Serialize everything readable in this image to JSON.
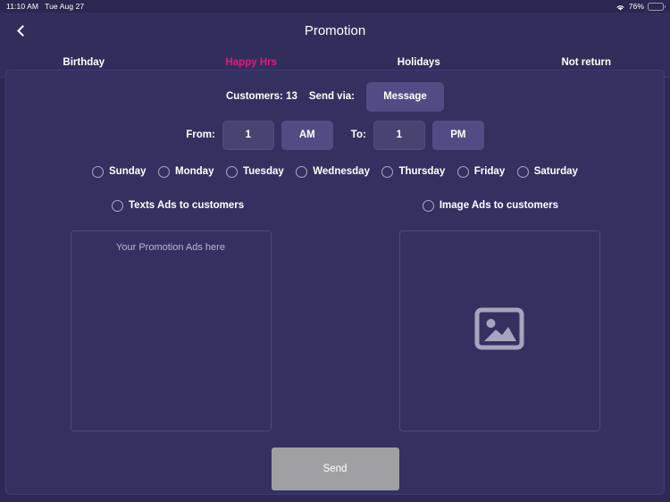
{
  "status_bar": {
    "time": "11:10 AM",
    "date": "Tue Aug 27",
    "battery_percent": "76%",
    "wifi_icon": "wifi-icon",
    "battery_icon": "battery-icon"
  },
  "header": {
    "back_icon": "chevron-left-icon",
    "title": "Promotion"
  },
  "tabs": [
    {
      "label": "Birthday",
      "active": false
    },
    {
      "label": "Happy Hrs",
      "active": true
    },
    {
      "label": "Holidays",
      "active": false
    },
    {
      "label": "Not return",
      "active": false
    }
  ],
  "form": {
    "customers_label": "Customers: 13",
    "send_via_label": "Send via:",
    "send_via_value": "Message",
    "from_label": "From:",
    "from_hour": "1",
    "from_meridiem": "AM",
    "to_label": "To:",
    "to_hour": "1",
    "to_meridiem": "PM",
    "days": [
      {
        "label": "Sunday",
        "selected": false
      },
      {
        "label": "Monday",
        "selected": false
      },
      {
        "label": "Tuesday",
        "selected": false
      },
      {
        "label": "Wednesday",
        "selected": false
      },
      {
        "label": "Thursday",
        "selected": false
      },
      {
        "label": "Friday",
        "selected": false
      },
      {
        "label": "Saturday",
        "selected": false
      }
    ],
    "ad_types": [
      {
        "label": "Texts Ads to customers",
        "selected": false
      },
      {
        "label": "Image Ads to customers",
        "selected": false
      }
    ],
    "text_ads": {
      "placeholder": "Your Promotion Ads here",
      "value": ""
    },
    "image_ads": {
      "icon": "image-placeholder-icon"
    },
    "send_button_label": "Send"
  },
  "colors": {
    "background": "#2e2a55",
    "panel": "#343161",
    "accent_pink": "#e8177d",
    "button_indigo": "#504d84",
    "send_disabled": "#a0a0a4",
    "battery_green": "#4cd964"
  }
}
